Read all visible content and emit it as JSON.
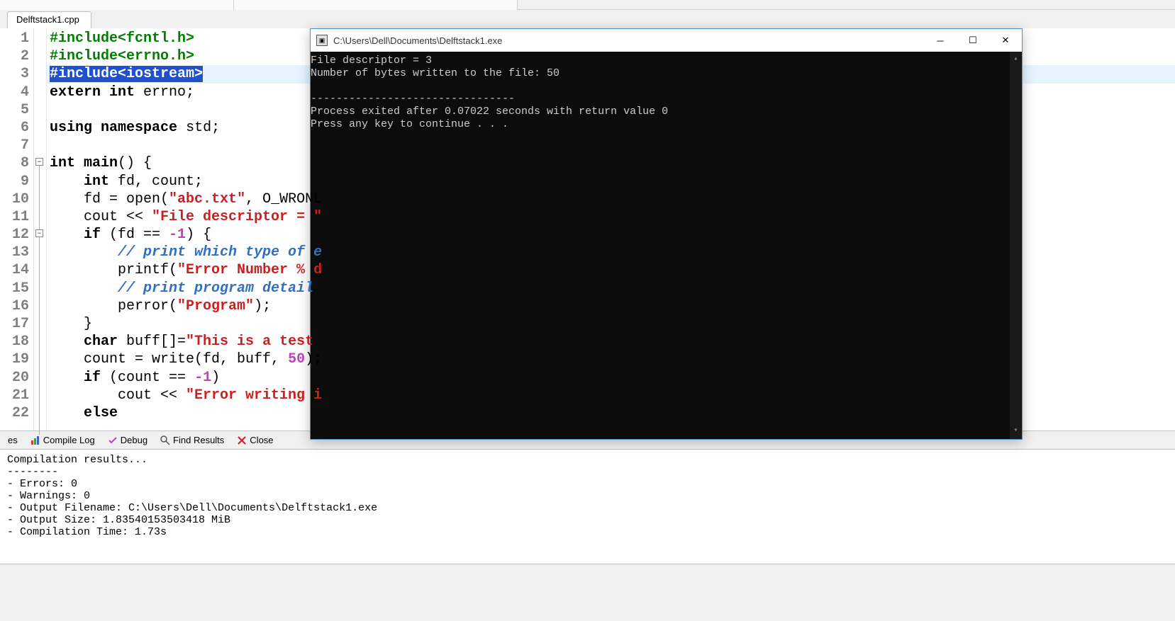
{
  "tab": {
    "filename": "Delftstack1.cpp"
  },
  "code": {
    "lines": [
      {
        "n": "1",
        "pp": "#include<fcntl.h>"
      },
      {
        "n": "2",
        "pp": "#include<errno.h>"
      },
      {
        "n": "3",
        "ppsel": "#include<iostream>"
      },
      {
        "n": "4",
        "l4_kw1": "extern",
        "l4_kw2": "int",
        "l4_id": " errno",
        "l4_semi": ";"
      },
      {
        "n": "5"
      },
      {
        "n": "6",
        "l6_kw1": "using",
        "l6_kw2": "namespace",
        "l6_id": " std",
        "l6_semi": ";"
      },
      {
        "n": "7"
      },
      {
        "n": "8",
        "l8_kw1": "int",
        "l8_fn": " main",
        "l8_paren": "()",
        "l8_brace": " {"
      },
      {
        "n": "9",
        "l9_indent": "    ",
        "l9_kw": "int",
        "l9_rest": " fd, count;"
      },
      {
        "n": "10",
        "l10_indent": "    ",
        "l10_a": "fd = open(",
        "l10_str": "\"abc.txt\"",
        "l10_b": ", O_WRONL"
      },
      {
        "n": "11",
        "l11_indent": "    ",
        "l11_a": "cout << ",
        "l11_str": "\"File descriptor = \""
      },
      {
        "n": "12",
        "l12_indent": "    ",
        "l12_kw": "if",
        "l12_a": " (fd == ",
        "l12_num": "-1",
        "l12_b": ") {"
      },
      {
        "n": "13",
        "l13_indent": "        ",
        "l13_cmt": "// print which type of e"
      },
      {
        "n": "14",
        "l14_indent": "        ",
        "l14_a": "printf(",
        "l14_str": "\"Error Number % d"
      },
      {
        "n": "15",
        "l15_indent": "        ",
        "l15_cmt": "// print program detail"
      },
      {
        "n": "16",
        "l16_indent": "        ",
        "l16_a": "perror(",
        "l16_str": "\"Program\"",
        "l16_b": ");"
      },
      {
        "n": "17",
        "l17_indent": "    ",
        "l17_a": "}"
      },
      {
        "n": "18",
        "l18_indent": "    ",
        "l18_kw": "char",
        "l18_a": " buff[]=",
        "l18_str": "\"This is a test "
      },
      {
        "n": "19",
        "l19_indent": "    ",
        "l19_a": "count = write(fd, buff, ",
        "l19_num": "50",
        "l19_b": ");"
      },
      {
        "n": "20",
        "l20_indent": "    ",
        "l20_kw": "if",
        "l20_a": " (count == ",
        "l20_num": "-1",
        "l20_b": ")"
      },
      {
        "n": "21",
        "l21_indent": "        ",
        "l21_a": "cout << ",
        "l21_str": "\"Error writing i"
      },
      {
        "n": "22",
        "l22_indent": "    ",
        "l22_kw": "else"
      }
    ]
  },
  "console": {
    "title": "C:\\Users\\Dell\\Documents\\Delftstack1.exe",
    "out1": "File descriptor = 3",
    "out2": "Number of bytes written to the file: 50",
    "out3": "",
    "out4": "--------------------------------",
    "out5": "Process exited after 0.07022 seconds with return value 0",
    "out6": "Press any key to continue . . ."
  },
  "bottom_tabs": {
    "resources": "es",
    "compile_log": "Compile Log",
    "debug": "Debug",
    "find_results": "Find Results",
    "close": "Close"
  },
  "compile": {
    "header": "Compilation results...",
    "sep": "--------",
    "errors": "- Errors: 0",
    "warnings": "- Warnings: 0",
    "outfile": "- Output Filename: C:\\Users\\Dell\\Documents\\Delftstack1.exe",
    "outsize": "- Output Size: 1.83540153503418 MiB",
    "ctime": "- Compilation Time: 1.73s"
  }
}
